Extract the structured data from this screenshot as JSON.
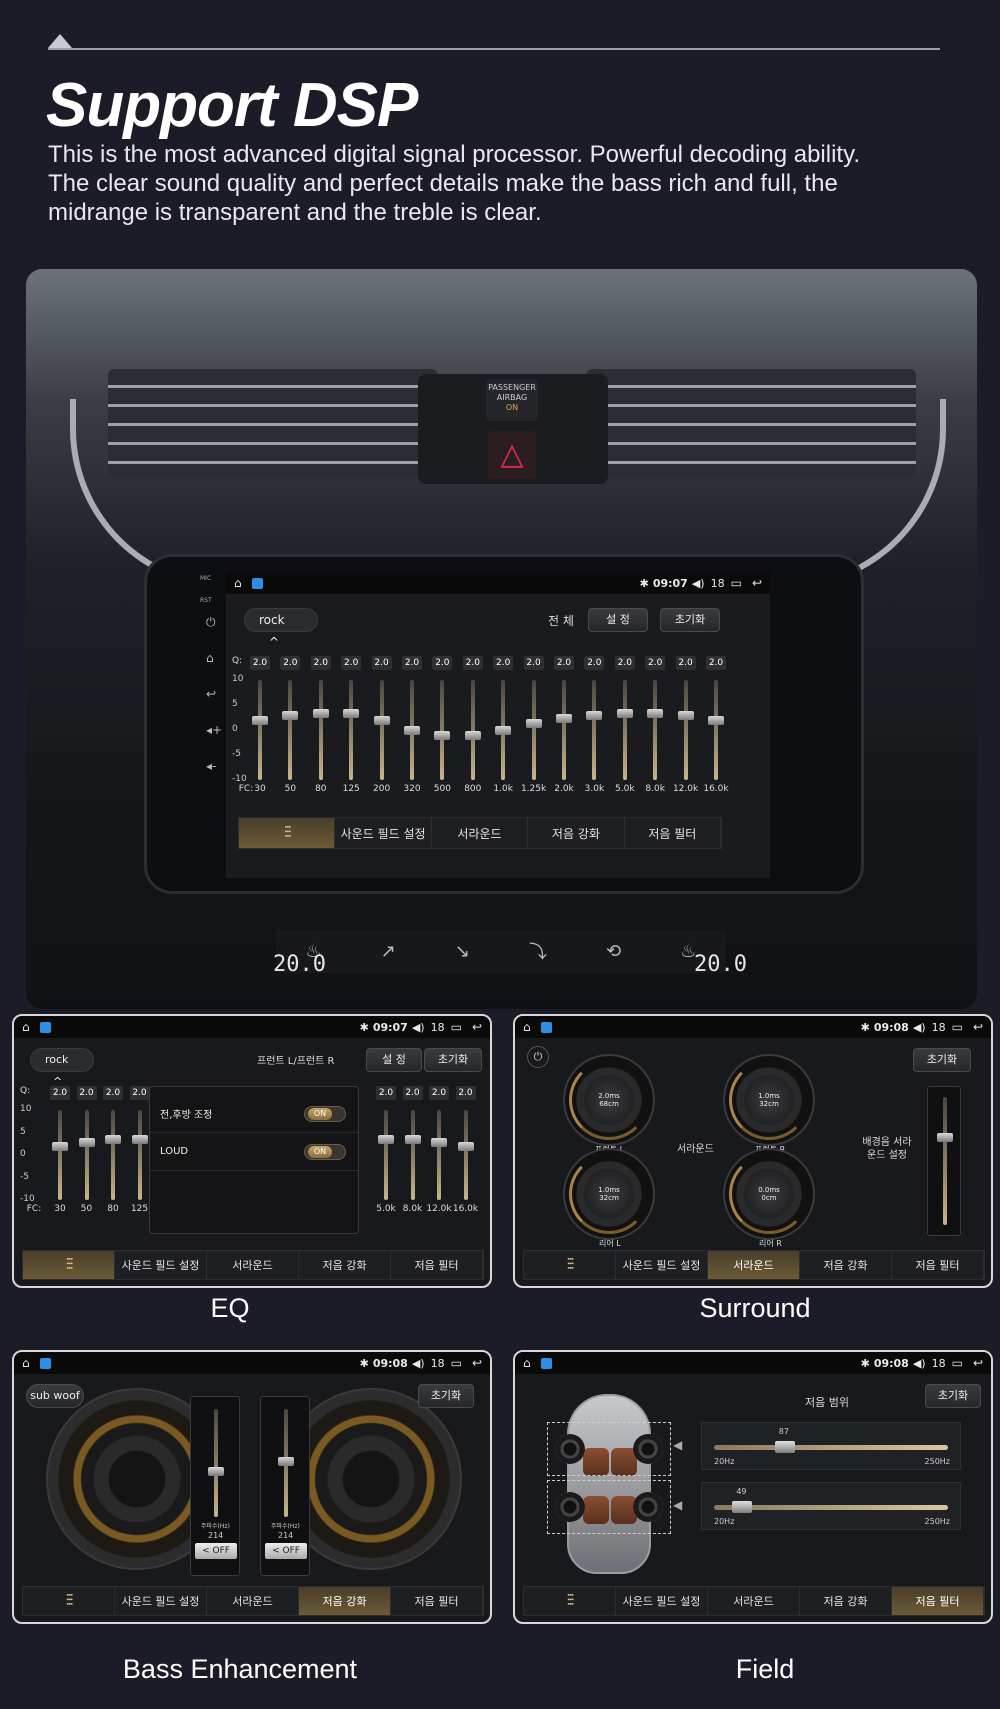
{
  "header": {
    "title": "Support DSP",
    "line1": "This is the most advanced digital signal processor. Powerful decoding ability.",
    "line2": "The clear sound quality and perfect details make the bass rich and full, the",
    "line3": "midrange is transparent and the treble is clear."
  },
  "car": {
    "airbag_label": "PASSENGER AIRBAG",
    "airbag_state": "ON",
    "temp_left": "20.0",
    "temp_right": "20.0"
  },
  "status": {
    "time_main": "09:07",
    "time_eq": "09:07",
    "time_other": "09:08",
    "volume": "18"
  },
  "main_screen": {
    "preset": "rock",
    "scope_label": "전 체",
    "settings_button": "설 정",
    "reset_button": "초기화",
    "q_label": "Q:",
    "fc_label": "FC:",
    "scale": [
      "10",
      "5",
      "0",
      "-5",
      "-10"
    ],
    "q_values": [
      "2.0",
      "2.0",
      "2.0",
      "2.0",
      "2.0",
      "2.0",
      "2.0",
      "2.0",
      "2.0",
      "2.0",
      "2.0",
      "2.0",
      "2.0",
      "2.0",
      "2.0",
      "2.0"
    ],
    "bands": [
      "30",
      "50",
      "80",
      "125",
      "200",
      "320",
      "500",
      "800",
      "1.0k",
      "1.25k",
      "2.0k",
      "3.0k",
      "5.0k",
      "8.0k",
      "12.0k",
      "16.0k"
    ],
    "gains_db": [
      2,
      3,
      3.5,
      3.5,
      2,
      0,
      -1,
      -1,
      0,
      1.5,
      2.5,
      3,
      3.5,
      3.5,
      3,
      2
    ]
  },
  "tabs": {
    "t1": "사운드 필드 설정",
    "t2": "서라운드",
    "t3": "저음 강화",
    "t4": "저음 필터"
  },
  "eq_panel": {
    "preset": "rock",
    "scope_label": "프런트 L/프런트 R",
    "settings_button": "설 정",
    "reset_button": "초기화",
    "q_label": "Q:",
    "fc_label": "FC:",
    "scale": [
      "10",
      "5",
      "0",
      "-5",
      "-10"
    ],
    "left_q": [
      "2.0",
      "2.0",
      "2.0",
      "2.0"
    ],
    "left_bands": [
      "30",
      "50",
      "80",
      "125"
    ],
    "right_q": [
      "2.0",
      "2.0",
      "2.0",
      "2.0"
    ],
    "right_bands": [
      "5.0k",
      "8.0k",
      "12.0k",
      "16.0k"
    ],
    "popup_row1": "전,후방 조정",
    "popup_row2": "LOUD",
    "toggle_on": "ON",
    "caption": "EQ"
  },
  "surround_panel": {
    "reset_button": "초기화",
    "center_label": "서라운드",
    "dial1_value": "2.0ms",
    "dial1_sub": "68cm",
    "dial1_name": "프런트 L",
    "dial2_value": "1.0ms",
    "dial2_sub": "32cm",
    "dial2_name": "프런트 R",
    "dial3_value": "1.0ms",
    "dial3_sub": "32cm",
    "dial3_name": "리어 L",
    "dial4_value": "0.0ms",
    "dial4_sub": "0cm",
    "dial4_name": "리어 R",
    "bg_label": "배경음 서라운드 설정",
    "caption": "Surround"
  },
  "bass_panel": {
    "subwoof_button": "sub woof",
    "reset_button": "초기화",
    "freq_label": "주파수(Hz)",
    "freq1": "214",
    "freq2": "214",
    "off_label": "OFF",
    "caption": "Bass Enhancement"
  },
  "field_panel": {
    "reset_button": "초기화",
    "range_title": "저음 범위",
    "slider1_value": "87",
    "slider1_level": 0.3,
    "slider2_value": "49",
    "slider2_level": 0.12,
    "min_label": "20Hz",
    "max_label": "250Hz",
    "caption": "Field"
  }
}
